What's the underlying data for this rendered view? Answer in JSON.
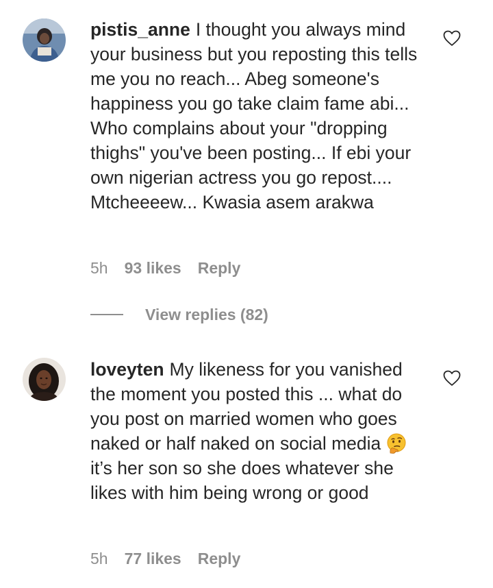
{
  "comments": [
    {
      "username": "pistis_anne",
      "text": "I thought you always mind your business but you reposting this tells me you no reach... Abeg someone's happiness you go take claim fame abi... Who complains about your \"dropping thighs\" you've been posting... If ebi your own nigerian actress you go repost.... Mtcheeeew... Kwasia asem arakwa",
      "time": "5h",
      "likes": "93 likes",
      "reply_label": "Reply",
      "view_replies": "View replies (82)"
    },
    {
      "username": "loveyten",
      "text_before_emoji": "My likeness for you vanished the moment you posted this ... what do you post on married women who goes naked or half naked on social media",
      "emoji": "thinking-face-icon",
      "text_after_emoji": "it’s her son so she does whatever she likes with him being wrong or good",
      "time": "5h",
      "likes": "77 likes",
      "reply_label": "Reply"
    }
  ],
  "colors": {
    "text": "#262626",
    "secondary": "#8e8e8e",
    "background": "#ffffff"
  },
  "icons": {
    "like": "heart-outline-icon"
  }
}
